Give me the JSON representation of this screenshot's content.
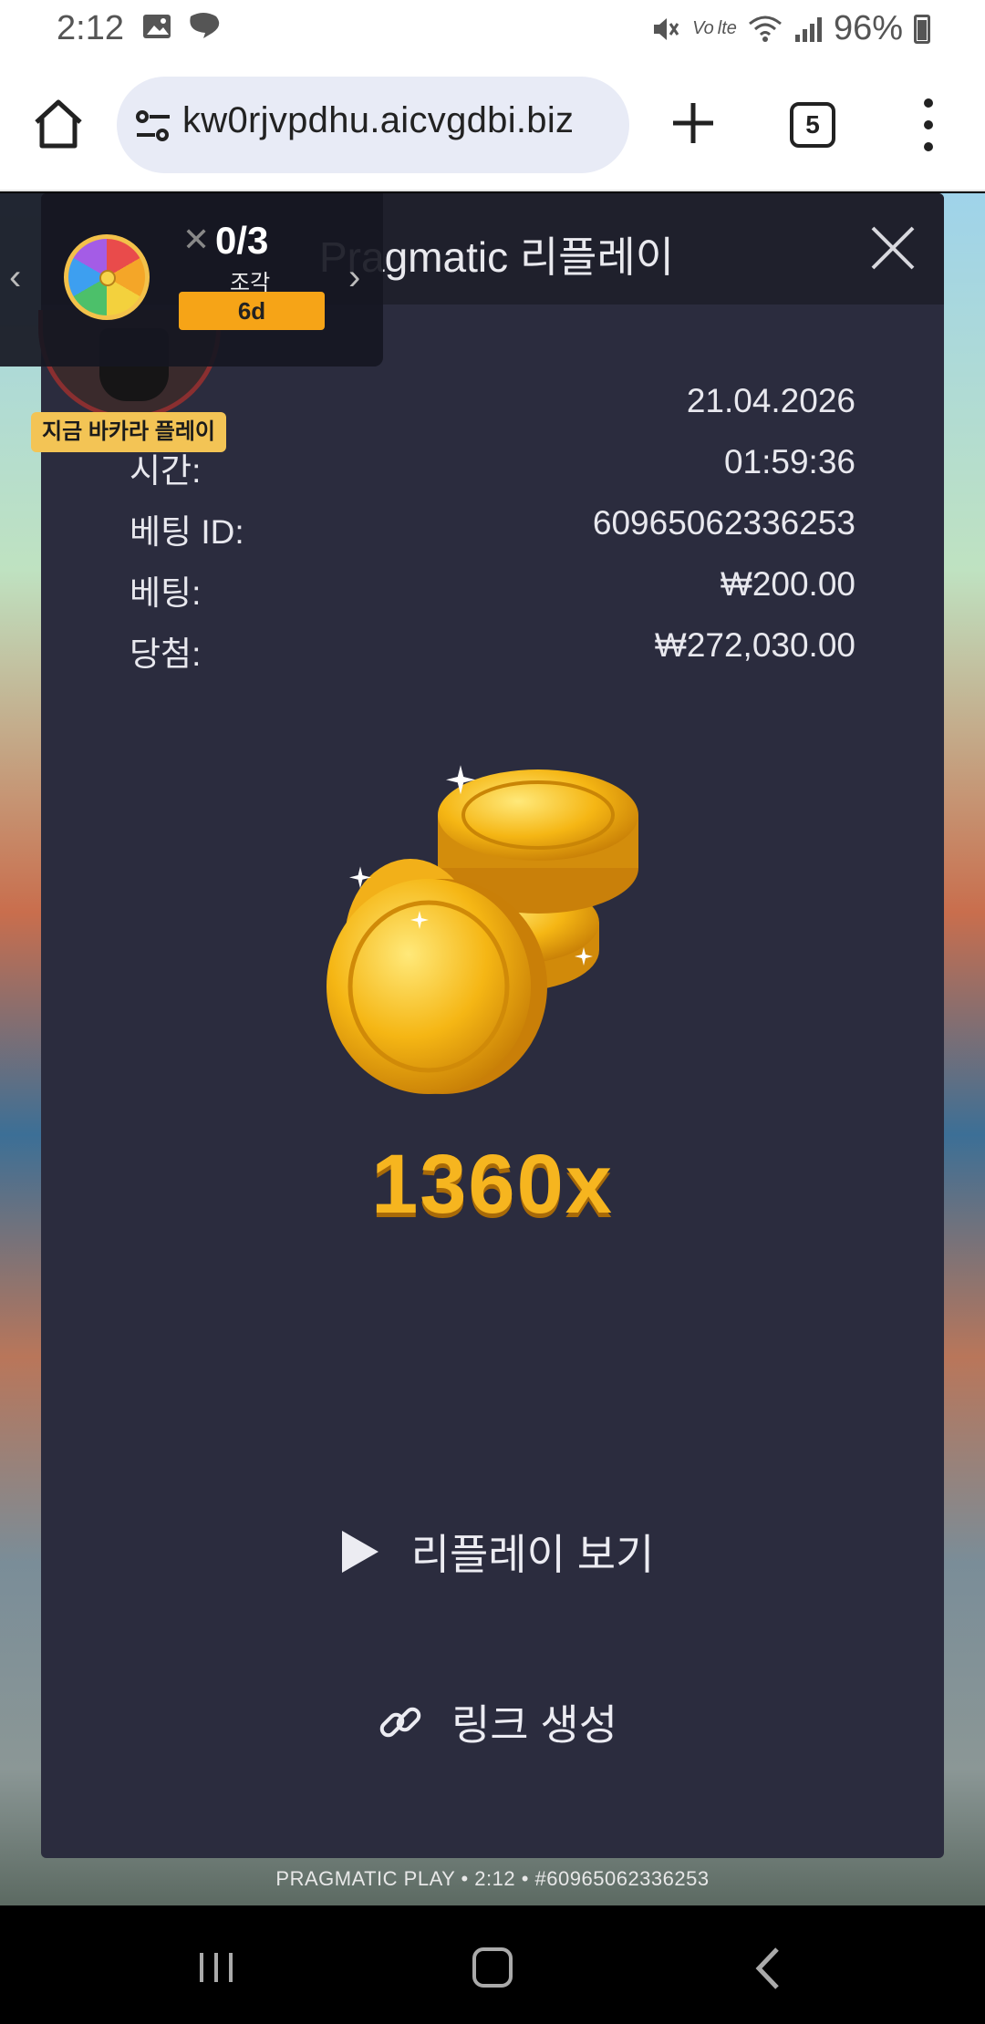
{
  "status_bar": {
    "time": "2:12",
    "signal_label": "Vo lte",
    "battery": "96%"
  },
  "browser": {
    "url": "kw0rjvpdhu.aicvgdbi.biz",
    "tab_count": "5"
  },
  "promo": {
    "count": "0/3",
    "unit": "조각",
    "badge": "6d",
    "baccarat_label": "지금 바카라 플레이"
  },
  "modal": {
    "title": "Pragmatic 리플레이",
    "rows": [
      {
        "label": "",
        "value": "21.04.2026"
      },
      {
        "label": "시간:",
        "value": "01:59:36"
      },
      {
        "label": "베팅 ID:",
        "value": "60965062336253"
      },
      {
        "label": "베팅:",
        "value": "₩200.00"
      },
      {
        "label": "당첨:",
        "value": "₩272,030.00"
      }
    ],
    "multiplier": "1360x",
    "replay_label": "리플레이 보기",
    "link_label": "링크 생성"
  },
  "game_footer": "PRAGMATIC PLAY • 2:12 • #60965062336253",
  "colors": {
    "modal_bg": "#2b2c3e",
    "header_bg": "#1f202c",
    "multiplier": "#f6b51f",
    "badge": "#f6a417"
  }
}
